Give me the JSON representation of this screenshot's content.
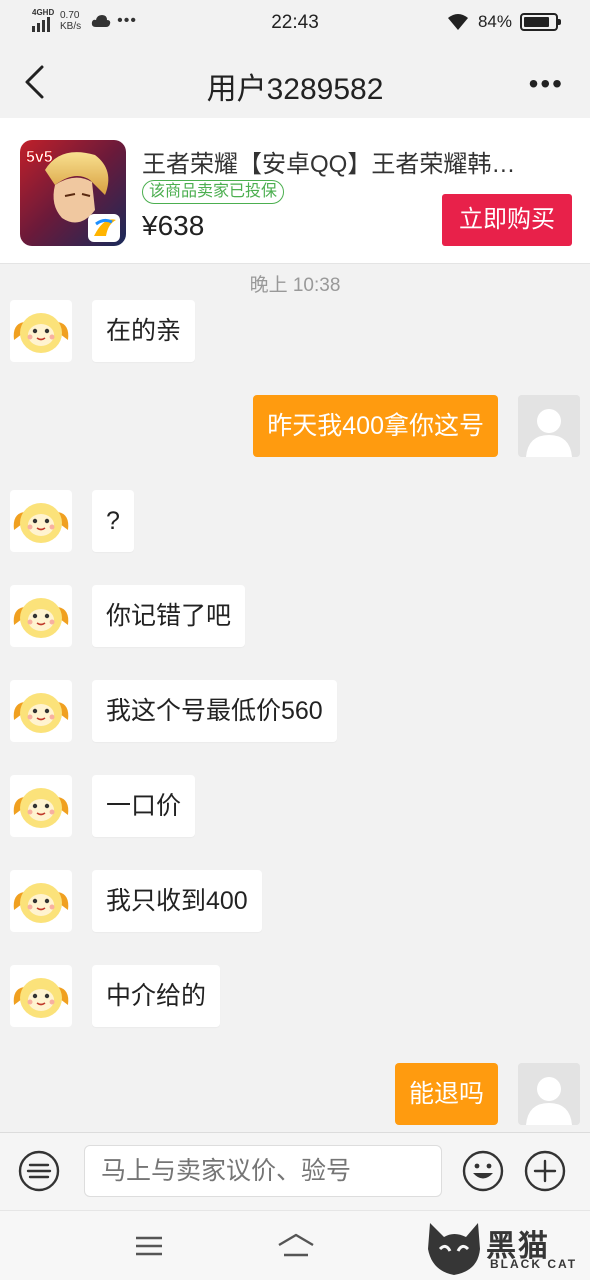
{
  "status_bar": {
    "network": "4GHD",
    "speed_value": "0.70",
    "speed_unit": "KB/s",
    "time": "22:43",
    "battery_percent": "84%",
    "battery_level": 0.84
  },
  "nav": {
    "title": "用户3289582"
  },
  "product": {
    "title": "王者荣耀【安卓QQ】王者荣耀韩…",
    "badge": "该商品卖家已投保",
    "price": "¥638",
    "buy_label": "立即购买",
    "badge_color": "#4caf50",
    "buy_color": "#e8214a"
  },
  "chat": {
    "timestamp": "晚上 10:38",
    "messages": [
      {
        "side": "left",
        "text": "在的亲"
      },
      {
        "side": "right",
        "text": "昨天我400拿你这号"
      },
      {
        "side": "left",
        "text": "?"
      },
      {
        "side": "left",
        "text": "你记错了吧"
      },
      {
        "side": "left",
        "text": "我这个号最低价560"
      },
      {
        "side": "left",
        "text": "一口价"
      },
      {
        "side": "left",
        "text": "我只收到400"
      },
      {
        "side": "left",
        "text": "中介给的"
      },
      {
        "side": "right",
        "text": "能退吗"
      }
    ],
    "my_bubble_color": "#ff9b0f"
  },
  "input_bar": {
    "placeholder": "马上与卖家议价、验号"
  },
  "watermark": {
    "text": "黑猫",
    "sub": "BLACK CAT"
  }
}
